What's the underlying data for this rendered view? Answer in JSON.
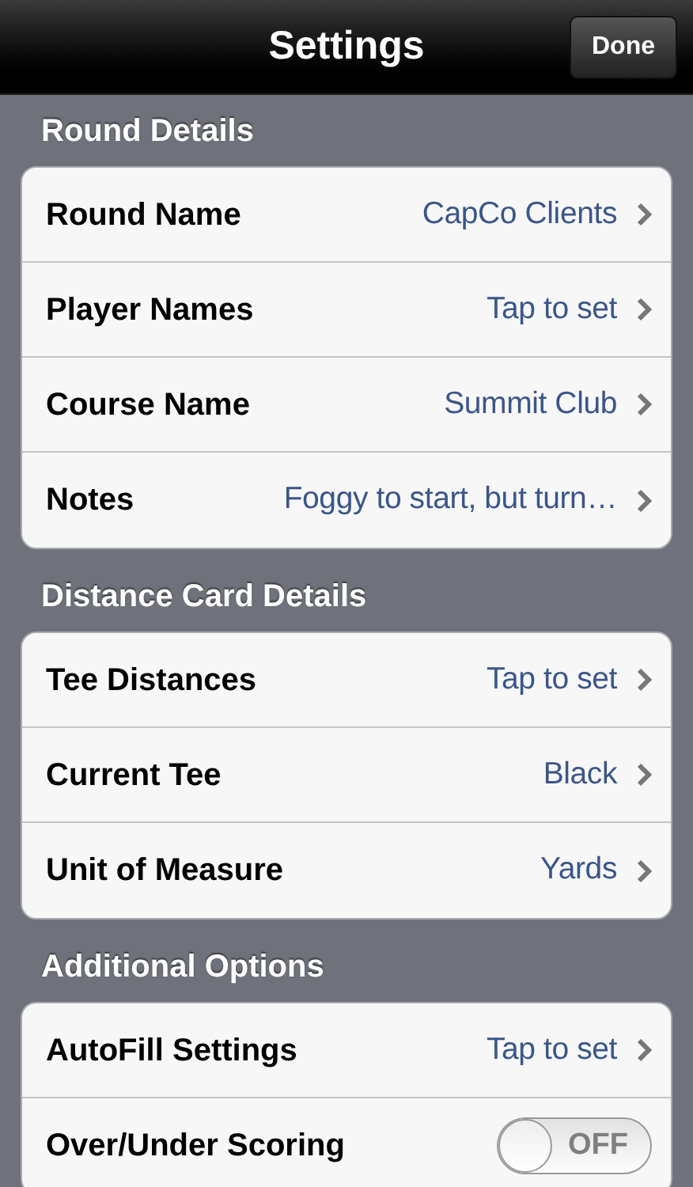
{
  "nav_bar": {
    "title": "Settings",
    "done_button": "Done"
  },
  "sections": [
    {
      "header": "Round Details",
      "rows": [
        {
          "kind": "link",
          "label": "Round Name",
          "value": "CapCo Clients"
        },
        {
          "kind": "link",
          "label": "Player Names",
          "value": "Tap to set"
        },
        {
          "kind": "link",
          "label": "Course Name",
          "value": "Summit Club"
        },
        {
          "kind": "link",
          "label": "Notes",
          "value": "Foggy to start, but turn…"
        }
      ]
    },
    {
      "header": "Distance Card Details",
      "rows": [
        {
          "kind": "link",
          "label": "Tee Distances",
          "value": "Tap to set"
        },
        {
          "kind": "link",
          "label": "Current Tee",
          "value": "Black"
        },
        {
          "kind": "link",
          "label": "Unit of Measure",
          "value": "Yards"
        }
      ]
    },
    {
      "header": "Additional Options",
      "rows": [
        {
          "kind": "link",
          "label": "AutoFill Settings",
          "value": "Tap to set"
        },
        {
          "kind": "toggle",
          "label": "Over/Under Scoring",
          "on": false,
          "switch_text": "OFF"
        }
      ]
    }
  ]
}
